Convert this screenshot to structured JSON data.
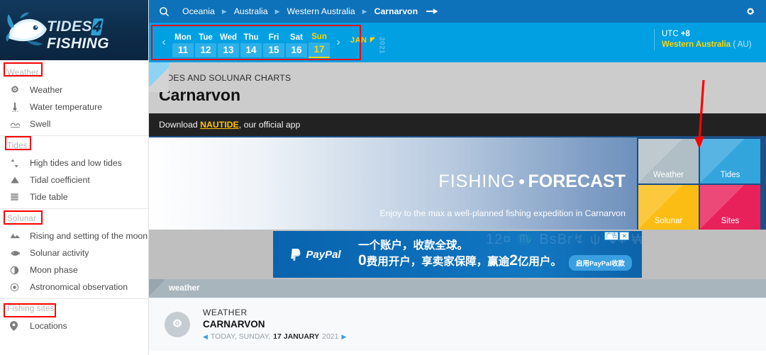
{
  "brand": {
    "name_part1": "TIDES",
    "name_four": "4",
    "name_part2": "FISHING",
    "logo_icon": "fish-logo-icon"
  },
  "sidebar": {
    "sections": [
      {
        "header": "Weather",
        "items": [
          {
            "label": "Weather",
            "icon": "gear-sun-icon"
          },
          {
            "label": "Water temperature",
            "icon": "thermometer-icon"
          },
          {
            "label": "Swell",
            "icon": "wave-icon"
          }
        ]
      },
      {
        "header": "Tides",
        "items": [
          {
            "label": "High tides and low tides",
            "icon": "up-down-arrows-icon"
          },
          {
            "label": "Tidal coefficient",
            "icon": "triangle-icon"
          },
          {
            "label": "Tide table",
            "icon": "table-rows-icon"
          }
        ]
      },
      {
        "header": "Solunar",
        "items": [
          {
            "label": "Rising and setting of the moon",
            "icon": "mountains-icon"
          },
          {
            "label": "Solunar activity",
            "icon": "fish-icon"
          },
          {
            "label": "Moon phase",
            "icon": "half-moon-icon"
          },
          {
            "label": "Astronomical observation",
            "icon": "target-circle-icon"
          }
        ]
      },
      {
        "header": "Fishing sites",
        "items": [
          {
            "label": "Locations",
            "icon": "map-pin-icon"
          }
        ]
      }
    ]
  },
  "topbar": {
    "search_icon": "search-icon",
    "settings_icon": "gear-icon",
    "breadcrumb": [
      "Oceania",
      "Australia",
      "Western Australia",
      "Carnarvon"
    ],
    "breadcrumb_active": "Carnarvon"
  },
  "datebar": {
    "prev_label": "‹",
    "next_label": "›",
    "days": [
      {
        "name": "Mon",
        "num": "11",
        "selected": false
      },
      {
        "name": "Tue",
        "num": "12",
        "selected": false
      },
      {
        "name": "Wed",
        "num": "13",
        "selected": false
      },
      {
        "name": "Thu",
        "num": "14",
        "selected": false
      },
      {
        "name": "Fri",
        "num": "15",
        "selected": false
      },
      {
        "name": "Sat",
        "num": "16",
        "selected": false
      },
      {
        "name": "Sun",
        "num": "17",
        "selected": true
      }
    ],
    "month": "JAN",
    "year": "2021",
    "timezone_label": "UTC",
    "timezone_offset": "+8",
    "region": "Western Australia",
    "country": "( AU)"
  },
  "title_block": {
    "subtitle": "TIDES AND SOLUNAR CHARTS",
    "title": "Carnarvon",
    "download_prefix": "Download ",
    "download_link": "NAUTIDE",
    "download_suffix": ", our official app"
  },
  "hero": {
    "title_thin": "FISHING",
    "title_dot": "●",
    "title_bold": "FORECAST",
    "subtitle": "Enjoy to the max a well-planned fishing expedition in Carnarvon",
    "tiles": [
      {
        "label": "Weather",
        "color": "#b0bec5"
      },
      {
        "label": "Tides",
        "color": "#33a5dd"
      },
      {
        "label": "Solunar",
        "color": "#fbbc14"
      },
      {
        "label": "Sites",
        "color": "#e8215b"
      }
    ]
  },
  "ad": {
    "brand": "PayPal",
    "brand_icon": "paypal-icon",
    "line1": "一个账户，收款全球。",
    "line2_a": "0",
    "line2_b": "费用开户，享卖家保障，赢逾",
    "line2_c": "2",
    "line2_d": "亿用户。",
    "cta": "启用PayPal收款",
    "tag": "广告",
    "close": "✕",
    "bg_numbers": "12¤ ♏ BsBr↯ ψ ↯¥ ₩ŦĦ"
  },
  "weather_section": {
    "bar_label": "weather",
    "icon": "gear-sun-icon",
    "kicker": "WEATHER",
    "city": "CARNARVON",
    "prev_icon": "left-triangle-icon",
    "next_icon": "right-triangle-icon",
    "date_today": "TODAY, SUNDAY,",
    "date_main": "17 JANUARY",
    "date_year": "2021"
  },
  "annotations": {
    "boxes": [
      {
        "name": "weather-header-box"
      },
      {
        "name": "tides-header-box"
      },
      {
        "name": "solunar-header-box"
      },
      {
        "name": "fishing-sites-header-box"
      },
      {
        "name": "date-strip-box"
      }
    ],
    "arrow": {
      "name": "red-down-arrow",
      "color": "#ff0000"
    }
  }
}
